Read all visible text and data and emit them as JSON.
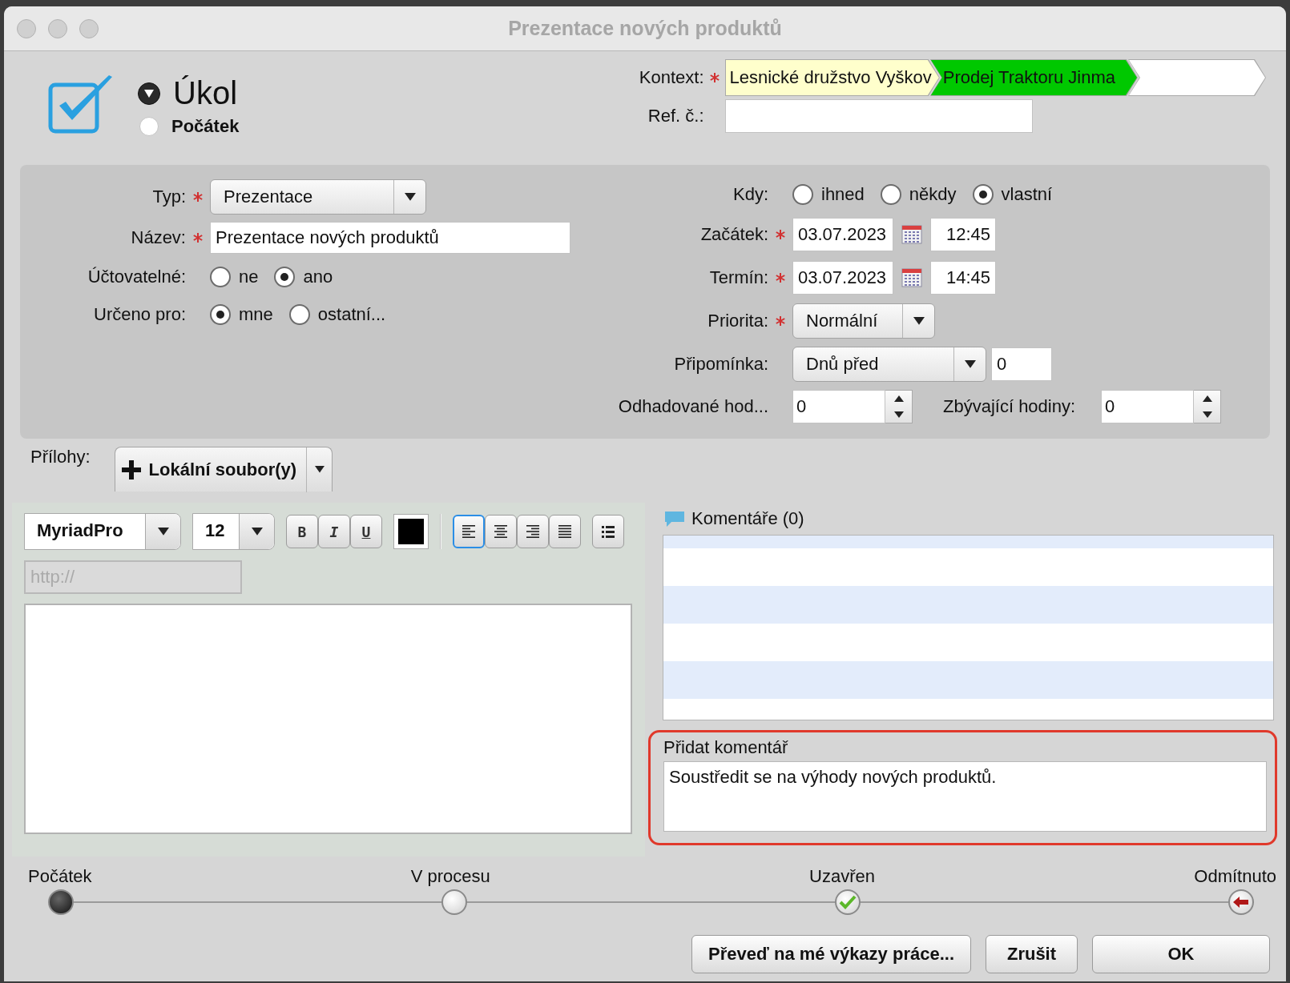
{
  "window": {
    "title": "Prezentace nových produktů"
  },
  "record_type": [
    {
      "label": "Úkol",
      "selected": true
    },
    {
      "label": "Počátek",
      "selected": false
    }
  ],
  "context": {
    "label": "Kontext:",
    "required": true,
    "path": [
      {
        "label": "Lesnické družstvo Vyškov",
        "color": "#ffffcc"
      },
      {
        "label": "Prodej Traktoru Jinma",
        "color": "#00c800"
      }
    ]
  },
  "ref_number": {
    "label": "Ref. č.:"
  },
  "details_left": [
    {
      "kind": "select",
      "label": "Typ:",
      "required": true,
      "value": "Prezentace"
    },
    {
      "kind": "text",
      "label": "Název:",
      "required": true,
      "value": "Prezentace nových produktů"
    },
    {
      "kind": "radio",
      "label": "Účtovatelné:",
      "required": false,
      "options": [
        {
          "label": "ne",
          "selected": false
        },
        {
          "label": "ano",
          "selected": true
        }
      ]
    },
    {
      "kind": "radio",
      "label": "Určeno pro:",
      "required": false,
      "options": [
        {
          "label": "mne",
          "selected": true
        },
        {
          "label": "ostatní...",
          "selected": false
        }
      ]
    }
  ],
  "details_right": [
    {
      "kind": "radio",
      "label": "Kdy:",
      "required": false,
      "options": [
        {
          "label": "ihned",
          "selected": false
        },
        {
          "label": "někdy",
          "selected": false
        },
        {
          "label": "vlastní",
          "selected": true
        }
      ]
    },
    {
      "kind": "datetime",
      "label": "Začátek:",
      "required": true,
      "date": "03.07.2023",
      "time": "12:45"
    },
    {
      "kind": "datetime",
      "label": "Termín:",
      "required": true,
      "date": "03.07.2023",
      "time": "14:45"
    },
    {
      "kind": "select",
      "label": "Priorita:",
      "required": true,
      "value": "Normální"
    },
    {
      "kind": "reminder",
      "label": "Připomínka:",
      "required": false,
      "value": "Dnů před",
      "count": "0"
    },
    {
      "kind": "hours",
      "label": "Odhadované hod...",
      "required": false,
      "value": "0",
      "extra_label": "Zbývající hodiny:",
      "extra_value": "0"
    }
  ],
  "attachments": {
    "label": "Přílohy:",
    "button": "Lokální soubor(y)"
  },
  "editor": {
    "font": "MyriadPro",
    "size": "12",
    "formats": [
      {
        "kind": "bold",
        "label": "B"
      },
      {
        "kind": "italic",
        "label": "I"
      },
      {
        "kind": "underline",
        "label": "U"
      }
    ],
    "alignments": [
      {
        "kind": "left",
        "selected": true
      },
      {
        "kind": "center",
        "selected": false
      },
      {
        "kind": "right",
        "selected": false
      },
      {
        "kind": "justify",
        "selected": false
      }
    ],
    "link_placeholder": "http://"
  },
  "comments": {
    "title": "Komentáře (0)",
    "add_label": "Přidat komentář",
    "new_comment": "Soustředit se na výhody nových produktů."
  },
  "status": [
    {
      "kind": "start",
      "label": "Počátek",
      "selected": true
    },
    {
      "kind": "progress",
      "label": "V procesu",
      "selected": false
    },
    {
      "kind": "done",
      "label": "Uzavřen",
      "selected": false
    },
    {
      "kind": "rejected",
      "label": "Odmítnuto",
      "selected": false
    }
  ],
  "buttons": [
    "Převeď na mé výkazy práce...",
    "Zrušit",
    "OK"
  ]
}
